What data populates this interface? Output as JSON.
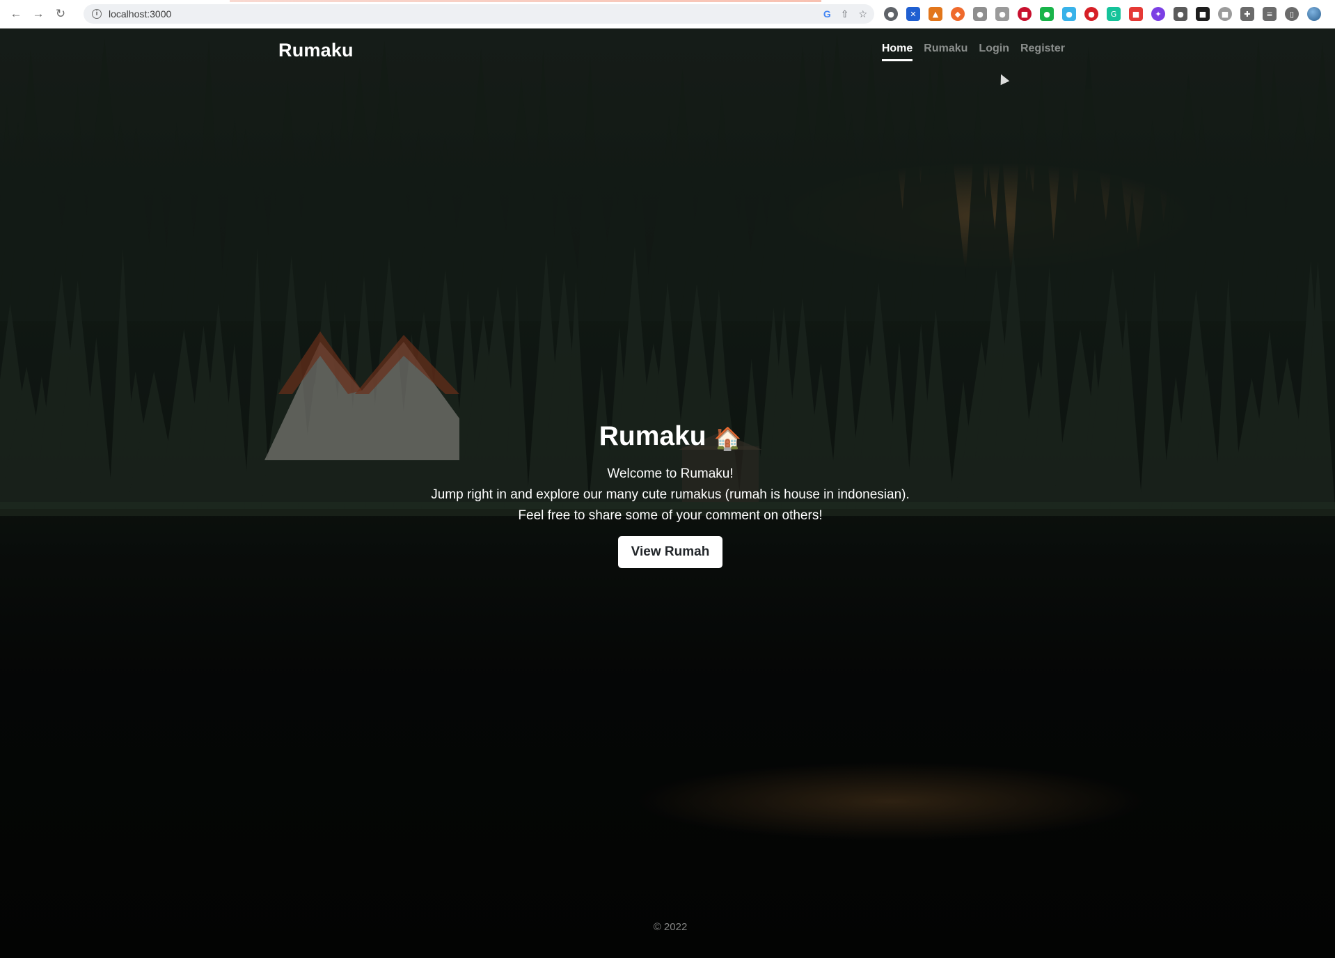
{
  "browser": {
    "url": "localhost:3000",
    "extensions": [
      {
        "name": "ext-1",
        "color": "#5f6368",
        "glyph": "●"
      },
      {
        "name": "ext-2",
        "color": "#1f5fd1",
        "glyph": "✕"
      },
      {
        "name": "metamask",
        "color": "#e2761b",
        "glyph": "▲"
      },
      {
        "name": "ext-4",
        "color": "#ef6a2c",
        "glyph": "◆"
      },
      {
        "name": "ext-5",
        "color": "#8e8e8e",
        "glyph": "●"
      },
      {
        "name": "ext-6",
        "color": "#9a9a9a",
        "glyph": "●"
      },
      {
        "name": "ext-7",
        "color": "#c8102e",
        "glyph": "■"
      },
      {
        "name": "ext-8",
        "color": "#19b44a",
        "glyph": "●"
      },
      {
        "name": "ext-9",
        "color": "#38b2e9",
        "glyph": "●"
      },
      {
        "name": "ext-10",
        "color": "#d61f26",
        "glyph": "●"
      },
      {
        "name": "grammarly",
        "color": "#15c39a",
        "glyph": "G"
      },
      {
        "name": "ext-12",
        "color": "#e53935",
        "glyph": "■"
      },
      {
        "name": "ext-13",
        "color": "#7b3fe4",
        "glyph": "✦"
      },
      {
        "name": "ext-14",
        "color": "#5a5a5a",
        "glyph": "●"
      },
      {
        "name": "ext-15",
        "color": "#1d1d1d",
        "glyph": "■"
      },
      {
        "name": "ext-16",
        "color": "#9b9b9b",
        "glyph": "■"
      },
      {
        "name": "extensions-puzzle",
        "color": "#6b6b6b",
        "glyph": "✚"
      },
      {
        "name": "reading-list",
        "color": "#6b6b6b",
        "glyph": "≡"
      },
      {
        "name": "side-panel",
        "color": "#6b6b6b",
        "glyph": "▯"
      }
    ]
  },
  "navbar": {
    "brand": "Rumaku",
    "links": [
      {
        "label": "Home",
        "active": true
      },
      {
        "label": "Rumaku",
        "active": false
      },
      {
        "label": "Login",
        "active": false
      },
      {
        "label": "Register",
        "active": false
      }
    ]
  },
  "hero": {
    "title": "Rumaku",
    "emoji": "🏠",
    "lines": [
      "Welcome to Rumaku!",
      "Jump right in and explore our many cute rumakus (rumah is house in indonesian).",
      "Feel free to share some of your comment on others!"
    ],
    "button_label": "View Rumah"
  },
  "footer": {
    "text": "© 2022"
  }
}
